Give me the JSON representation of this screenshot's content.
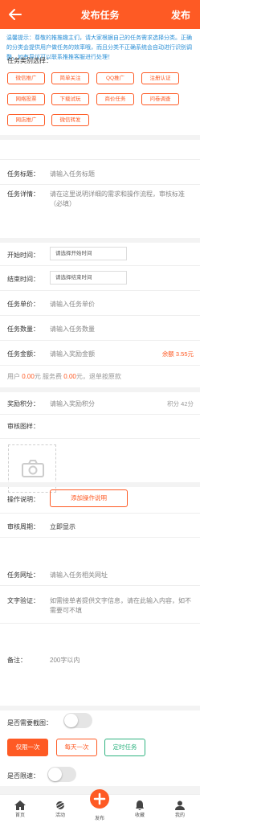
{
  "header": {
    "title": "发布任务",
    "publish_label": "发布"
  },
  "notice": "温馨提示：尊敬的推推趣主们，请大家根据自己的任务需求选择分类。正确的分类会提供用户做任务的效率哦，而且分类不正确系统会自动进行识别调整，如有异议可以联系推推客服进行处理！",
  "category": {
    "label": "任务类别选择：",
    "tags": [
      "微信推广",
      "简单关注",
      "QQ推广",
      "注册认证",
      "网络投票",
      "下载试玩",
      "商价任务",
      "问卷调查",
      "网店推广",
      "微信转发"
    ]
  },
  "fields": {
    "title_label": "任务标题：",
    "title_placeholder": "请输入任务标题",
    "detail_label": "任务详情：",
    "detail_placeholder": "请在这里说明详细的需求和操作流程，审核标准（必填）",
    "start_label": "开始时间：",
    "start_placeholder": "请选择开始时间",
    "end_label": "结束时间：",
    "end_placeholder": "请选择结束时间",
    "price_label": "任务单价：",
    "price_placeholder": "请输入任务单价",
    "qty_label": "任务数量：",
    "qty_placeholder": "请输入任务数量",
    "amount_label": "任务金额：",
    "amount_placeholder": "请输入奖励金额",
    "balance": "余额 3.55元",
    "fee_user_prefix": "用户",
    "fee_user_value": "0.00",
    "fee_unit1": "元",
    "fee_service_prefix": "服务费",
    "fee_service_value": "0.00",
    "fee_unit2": "元",
    "fee_refund": "，退单按原款",
    "points_label": "奖励积分：",
    "points_placeholder": "请输入奖励积分",
    "points_balance": "积分 42分",
    "image_label": "审核图样：",
    "op_label": "操作说明：",
    "op_button": "添加操作说明",
    "period_label": "审核周期：",
    "period_value": "立即显示",
    "url_label": "任务网址：",
    "url_placeholder": "请输入任务相关网址",
    "text_label": "文字验证：",
    "text_placeholder": "如需接单者提供文字信息，请在此输入内容，如不需要可不填",
    "note_label": "备注：",
    "note_placeholder": "200字以内"
  },
  "screenshot": {
    "label": "是否需要截图："
  },
  "limit": {
    "buttons": [
      "仅限一次",
      "每天一次",
      "定时任务"
    ]
  },
  "speed": {
    "label": "是否限速："
  },
  "tabbar": [
    "首页",
    "活动",
    "发布",
    "收藏",
    "我的"
  ],
  "colors": {
    "accent": "#fe5a24",
    "notice": "#2a8fd6",
    "green": "#2fb380"
  }
}
